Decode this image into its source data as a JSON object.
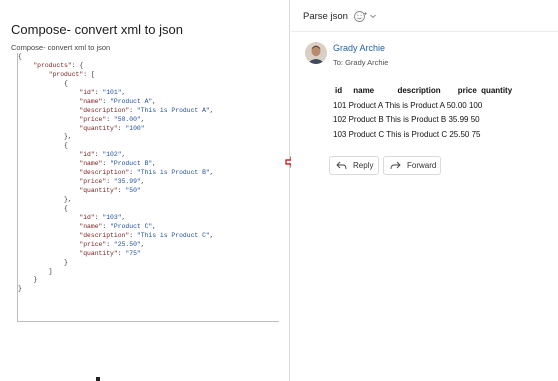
{
  "left": {
    "title": "Compose- convert xml to json",
    "subtitle": "Compose- convert xml to json",
    "code_lines": [
      [
        {
          "t": "pun",
          "v": "{"
        }
      ],
      [
        {
          "t": "pun",
          "v": "    "
        },
        {
          "t": "key",
          "v": "\"products\""
        },
        {
          "t": "pun",
          "v": ": {"
        }
      ],
      [
        {
          "t": "pun",
          "v": "        "
        },
        {
          "t": "key",
          "v": "\"product\""
        },
        {
          "t": "pun",
          "v": ": ["
        }
      ],
      [
        {
          "t": "pun",
          "v": "            {"
        }
      ],
      [
        {
          "t": "pun",
          "v": "                "
        },
        {
          "t": "key",
          "v": "\"id\""
        },
        {
          "t": "pun",
          "v": ": "
        },
        {
          "t": "str",
          "v": "\"101\""
        },
        {
          "t": "pun",
          "v": ","
        }
      ],
      [
        {
          "t": "pun",
          "v": "                "
        },
        {
          "t": "key",
          "v": "\"name\""
        },
        {
          "t": "pun",
          "v": ": "
        },
        {
          "t": "str",
          "v": "\"Product A\""
        },
        {
          "t": "pun",
          "v": ","
        }
      ],
      [
        {
          "t": "pun",
          "v": "                "
        },
        {
          "t": "key",
          "v": "\"description\""
        },
        {
          "t": "pun",
          "v": ": "
        },
        {
          "t": "str",
          "v": "\"This is Product A\""
        },
        {
          "t": "pun",
          "v": ","
        }
      ],
      [
        {
          "t": "pun",
          "v": "                "
        },
        {
          "t": "key",
          "v": "\"price\""
        },
        {
          "t": "pun",
          "v": ": "
        },
        {
          "t": "str",
          "v": "\"50.00\""
        },
        {
          "t": "pun",
          "v": ","
        }
      ],
      [
        {
          "t": "pun",
          "v": "                "
        },
        {
          "t": "key",
          "v": "\"quantity\""
        },
        {
          "t": "pun",
          "v": ": "
        },
        {
          "t": "str",
          "v": "\"100\""
        }
      ],
      [
        {
          "t": "pun",
          "v": "            },"
        }
      ],
      [
        {
          "t": "pun",
          "v": "            {"
        }
      ],
      [
        {
          "t": "pun",
          "v": "                "
        },
        {
          "t": "key",
          "v": "\"id\""
        },
        {
          "t": "pun",
          "v": ": "
        },
        {
          "t": "str",
          "v": "\"102\""
        },
        {
          "t": "pun",
          "v": ","
        }
      ],
      [
        {
          "t": "pun",
          "v": "                "
        },
        {
          "t": "key",
          "v": "\"name\""
        },
        {
          "t": "pun",
          "v": ": "
        },
        {
          "t": "str",
          "v": "\"Product B\""
        },
        {
          "t": "pun",
          "v": ","
        }
      ],
      [
        {
          "t": "pun",
          "v": "                "
        },
        {
          "t": "key",
          "v": "\"description\""
        },
        {
          "t": "pun",
          "v": ": "
        },
        {
          "t": "str",
          "v": "\"This is Product B\""
        },
        {
          "t": "pun",
          "v": ","
        }
      ],
      [
        {
          "t": "pun",
          "v": "                "
        },
        {
          "t": "key",
          "v": "\"price\""
        },
        {
          "t": "pun",
          "v": ": "
        },
        {
          "t": "str",
          "v": "\"35.99\""
        },
        {
          "t": "pun",
          "v": ","
        }
      ],
      [
        {
          "t": "pun",
          "v": "                "
        },
        {
          "t": "key",
          "v": "\"quantity\""
        },
        {
          "t": "pun",
          "v": ": "
        },
        {
          "t": "str",
          "v": "\"50\""
        }
      ],
      [
        {
          "t": "pun",
          "v": "            },"
        }
      ],
      [
        {
          "t": "pun",
          "v": "            {"
        }
      ],
      [
        {
          "t": "pun",
          "v": "                "
        },
        {
          "t": "key",
          "v": "\"id\""
        },
        {
          "t": "pun",
          "v": ": "
        },
        {
          "t": "str",
          "v": "\"103\""
        },
        {
          "t": "pun",
          "v": ","
        }
      ],
      [
        {
          "t": "pun",
          "v": "                "
        },
        {
          "t": "key",
          "v": "\"name\""
        },
        {
          "t": "pun",
          "v": ": "
        },
        {
          "t": "str",
          "v": "\"Product C\""
        },
        {
          "t": "pun",
          "v": ","
        }
      ],
      [
        {
          "t": "pun",
          "v": "                "
        },
        {
          "t": "key",
          "v": "\"description\""
        },
        {
          "t": "pun",
          "v": ": "
        },
        {
          "t": "str",
          "v": "\"This is Product C\""
        },
        {
          "t": "pun",
          "v": ","
        }
      ],
      [
        {
          "t": "pun",
          "v": "                "
        },
        {
          "t": "key",
          "v": "\"price\""
        },
        {
          "t": "pun",
          "v": ": "
        },
        {
          "t": "str",
          "v": "\"25.50\""
        },
        {
          "t": "pun",
          "v": ","
        }
      ],
      [
        {
          "t": "pun",
          "v": "                "
        },
        {
          "t": "key",
          "v": "\"quantity\""
        },
        {
          "t": "pun",
          "v": ": "
        },
        {
          "t": "str",
          "v": "\"75\""
        }
      ],
      [
        {
          "t": "pun",
          "v": "            }"
        }
      ],
      [
        {
          "t": "pun",
          "v": "        ]"
        }
      ],
      [
        {
          "t": "pun",
          "v": "    }"
        }
      ],
      [
        {
          "t": "pun",
          "v": "}"
        }
      ]
    ]
  },
  "colors": {
    "json_key": "#7b1c1c",
    "json_string": "#1f4fa3",
    "arrow": "#c62828",
    "link": "#2264a8"
  },
  "right": {
    "window_title": "Parse json",
    "icons": [
      "emoji-smile-icon",
      "chevron-down-icon",
      "arrow-right-icon",
      "reply-icon",
      "forward-icon"
    ],
    "sender_name": "Grady Archie",
    "to_line": "To:  Grady Archie",
    "table_header": [
      "id",
      "name",
      "description",
      "price",
      "quantity"
    ],
    "table_rows": [
      "101 Product A This is Product A 50.00 100",
      "102 Product B This is Product B 35.99 50",
      "103 Product C This is Product C 25.50 75"
    ],
    "reply_label": "Reply",
    "forward_label": "Forward"
  }
}
